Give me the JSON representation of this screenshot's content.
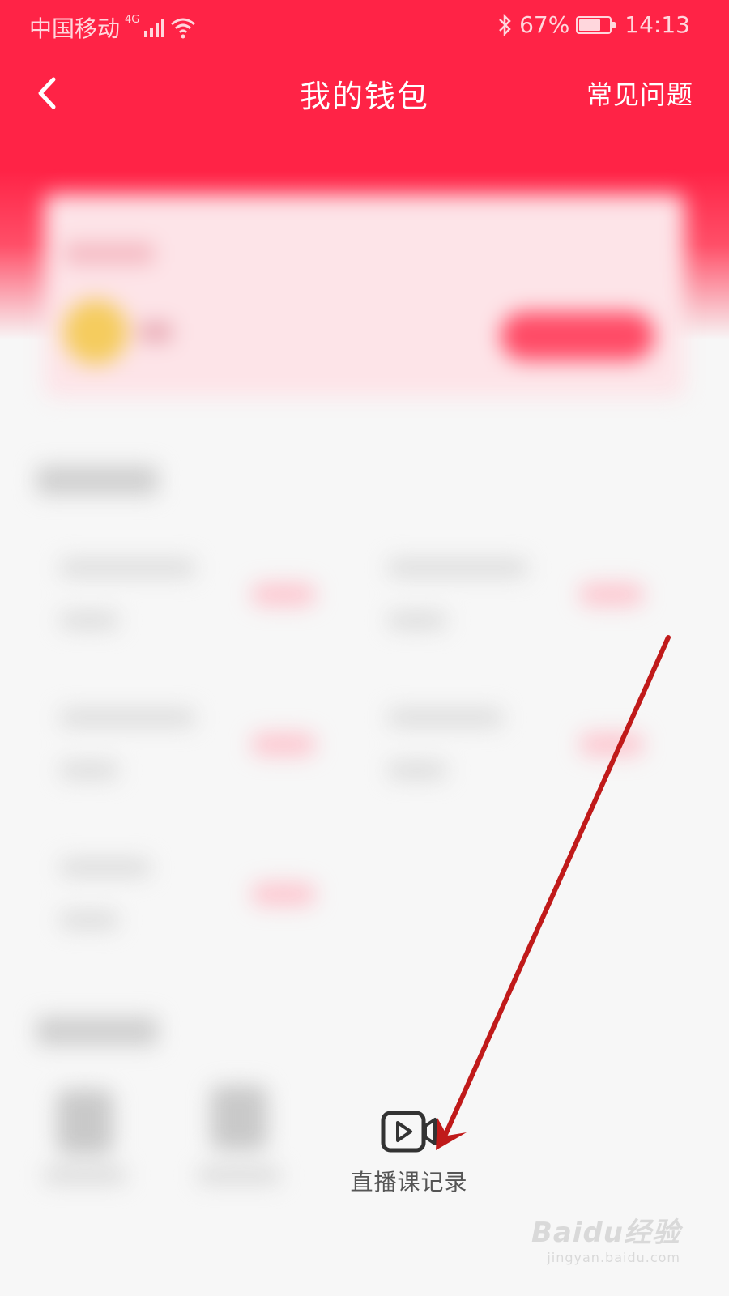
{
  "status_bar": {
    "carrier": "中国移动",
    "network": "4G",
    "battery": "67%",
    "time": "14:13"
  },
  "header": {
    "title": "我的钱包",
    "faq_label": "常见问题"
  },
  "entry": {
    "label": "直播课记录",
    "icon": "video-camera-icon"
  },
  "watermark": {
    "brand": "Baidu经验",
    "url": "jingyan.baidu.com"
  },
  "colors": {
    "header_red": "#ff2346",
    "annotation_arrow": "#c01a1a"
  }
}
